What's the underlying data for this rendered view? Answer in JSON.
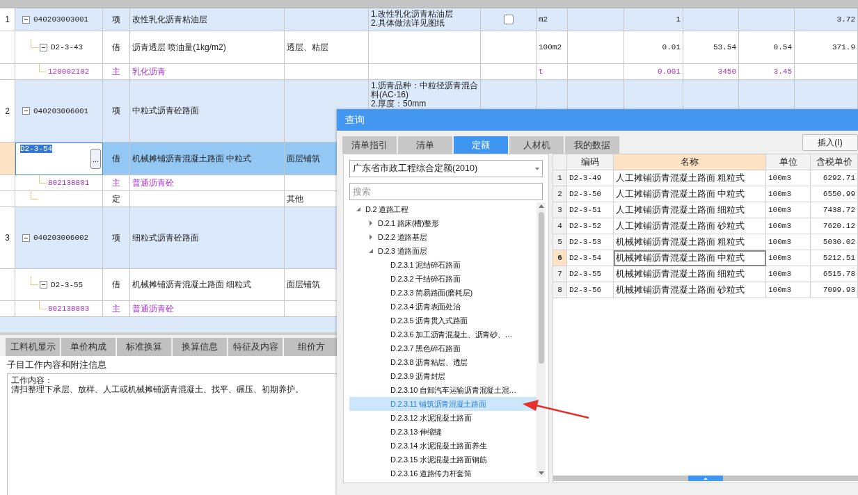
{
  "grid": {
    "rows": [
      {
        "kind": "list_item",
        "row_number": "1",
        "code": "040203003001",
        "type": "项",
        "name": "改性乳化沥青粘油层",
        "description": [
          "1.改性乳化沥青粘油层",
          "2.具体做法详见图纸"
        ],
        "checked": false,
        "unit": "m2",
        "column_10": "1",
        "column_13": "3.72",
        "expanded": true,
        "selected": false,
        "children": [
          {
            "kind": "quota",
            "code": "D2-3-43",
            "type": "借",
            "name": "沥青透层 喷油量(1kg/m2)",
            "feature": "透层、粘层",
            "unit": "100m2",
            "column_10": "0.01",
            "column_11": "53.54",
            "column_12": "0.54",
            "column_13": "371.9",
            "expanded": true,
            "selected": false,
            "children": [
              {
                "kind": "material",
                "code": "120002102",
                "type": "主",
                "name": "乳化沥青",
                "unit": "t",
                "column_10": "0.001",
                "column_11": "3450",
                "column_12": "3.45",
                "selected": false
              }
            ]
          }
        ]
      },
      {
        "kind": "list_item",
        "row_number": "2",
        "code": "040203006001",
        "type": "项",
        "name": "中粒式沥青砼路面",
        "description": [
          "1.沥青品种：中粒径沥青混合料(AC-16)",
          "2.厚度：50mm"
        ],
        "expanded": true,
        "selected": false,
        "children": [
          {
            "kind": "quota",
            "code": "D2-3-54",
            "edit_button": "...",
            "type": "借",
            "name": "机械摊铺沥青混凝土路面 中粒式",
            "feature": "面层铺筑",
            "selected": true,
            "children": [
              {
                "kind": "material",
                "code": "802138801",
                "type": "主",
                "name": "普通沥青砼",
                "selected": false
              }
            ]
          },
          {
            "kind": "quota",
            "type": "定",
            "feature": "其他",
            "selected": false
          }
        ]
      },
      {
        "kind": "list_item",
        "row_number": "3",
        "code": "040203006002",
        "type": "项",
        "name": "细粒式沥青砼路面",
        "expanded": true,
        "selected": false,
        "children": [
          {
            "kind": "quota",
            "code": "D2-3-55",
            "type": "借",
            "name": "机械摊铺沥青混凝土路面 细粒式",
            "feature": "面层铺筑",
            "expanded": true,
            "selected": false,
            "children": [
              {
                "kind": "material",
                "code": "802138803",
                "type": "主",
                "name": "普通沥青砼",
                "selected": false
              }
            ]
          }
        ]
      }
    ]
  },
  "detail": {
    "tabs": [
      {
        "label": "工料机显示",
        "selected": false
      },
      {
        "label": "单价构成",
        "selected": false
      },
      {
        "label": "标准换算",
        "selected": false
      },
      {
        "label": "换算信息",
        "selected": false
      },
      {
        "label": "特征及内容",
        "selected": false
      },
      {
        "label": "组价方",
        "selected": false
      }
    ],
    "section_label": "子目工作内容和附注信息",
    "notes": [
      "工作内容：",
      "清扫整理下承层、放样、人工或机械摊铺沥青混凝土、找平、碾压、初期养护。"
    ]
  },
  "dialog": {
    "title": "查询",
    "tabs": [
      {
        "label": "清单指引",
        "selected": false
      },
      {
        "label": "清单",
        "selected": false
      },
      {
        "label": "定额",
        "selected": true
      },
      {
        "label": "人材机",
        "selected": false
      },
      {
        "label": "我的数据",
        "selected": false
      }
    ],
    "insert_button": "插入(I)",
    "library": "广东省市政工程综合定额(2010)",
    "search": {
      "placeholder": "搜索"
    },
    "tree": [
      {
        "label": "D.2 道路工程",
        "expanded": true,
        "selected": false,
        "children": [
          {
            "label": "D.2.1 路床(槽)整形",
            "expanded": false,
            "selected": false
          },
          {
            "label": "D.2.2 道路基层",
            "expanded": false,
            "selected": false
          },
          {
            "label": "D.2.3 道路面层",
            "expanded": true,
            "selected": false,
            "children": [
              {
                "label": "D.2.3.1 泥结碎石路面",
                "selected": false
              },
              {
                "label": "D.2.3.2 干结碎石路面",
                "selected": false
              },
              {
                "label": "D.2.3.3 简易路面(磨耗层)",
                "selected": false
              },
              {
                "label": "D.2.3.4 沥青表面处治",
                "selected": false
              },
              {
                "label": "D.2.3.5 沥青贯入式路面",
                "selected": false
              },
              {
                "label": "D.2.3.6 加工沥青混凝土、沥青砂、…",
                "selected": false
              },
              {
                "label": "D.2.3.7 黑色碎石路面",
                "selected": false
              },
              {
                "label": "D.2.3.8 沥青粘层、透层",
                "selected": false
              },
              {
                "label": "D.2.3.9 沥青封层",
                "selected": false
              },
              {
                "label": "D.2.3.10 自卸汽车运输沥青混凝土混…",
                "selected": false
              },
              {
                "label": "D.2.3.11 铺筑沥青混凝土路面",
                "selected": true
              },
              {
                "label": "D.2.3.12 水泥混凝土路面",
                "selected": false
              },
              {
                "label": "D.2.3.13 伸缩缝",
                "selected": false
              },
              {
                "label": "D.2.3.14 水泥混凝土路面养生",
                "selected": false
              },
              {
                "label": "D.2.3.15 水泥混凝土路面钢筋",
                "selected": false
              },
              {
                "label": "D.2.3.16 道路传力杆套筒",
                "selected": false
              }
            ]
          }
        ]
      }
    ],
    "table": {
      "columns": [
        {
          "label": "编码",
          "focused": false
        },
        {
          "label": "名称",
          "focused": true
        },
        {
          "label": "单位",
          "focused": false
        },
        {
          "label": "含税单价",
          "focused": false
        }
      ],
      "rows": [
        {
          "row_number": "1",
          "code": "D2-3-49",
          "name": "人工摊铺沥青混凝土路面 粗粒式",
          "unit": "100m3",
          "price": "6292.71",
          "selected": false
        },
        {
          "row_number": "2",
          "code": "D2-3-50",
          "name": "人工摊铺沥青混凝土路面 中粒式",
          "unit": "100m3",
          "price": "6550.99",
          "selected": false
        },
        {
          "row_number": "3",
          "code": "D2-3-51",
          "name": "人工摊铺沥青混凝土路面 细粒式",
          "unit": "100m3",
          "price": "7438.72",
          "selected": false
        },
        {
          "row_number": "4",
          "code": "D2-3-52",
          "name": "人工摊铺沥青混凝土路面 砂粒式",
          "unit": "100m3",
          "price": "7620.12",
          "selected": false
        },
        {
          "row_number": "5",
          "code": "D2-3-53",
          "name": "机械摊铺沥青混凝土路面 粗粒式",
          "unit": "100m3",
          "price": "5030.02",
          "selected": false
        },
        {
          "row_number": "6",
          "code": "D2-3-54",
          "name": "机械摊铺沥青混凝土路面 中粒式",
          "unit": "100m3",
          "price": "5212.51",
          "selected": true
        },
        {
          "row_number": "7",
          "code": "D2-3-55",
          "name": "机械摊铺沥青混凝土路面 细粒式",
          "unit": "100m3",
          "price": "6515.78",
          "selected": false
        },
        {
          "row_number": "8",
          "code": "D2-3-56",
          "name": "机械摊铺沥青混凝土路面 砂粒式",
          "unit": "100m3",
          "price": "7099.93",
          "selected": false
        }
      ]
    }
  }
}
